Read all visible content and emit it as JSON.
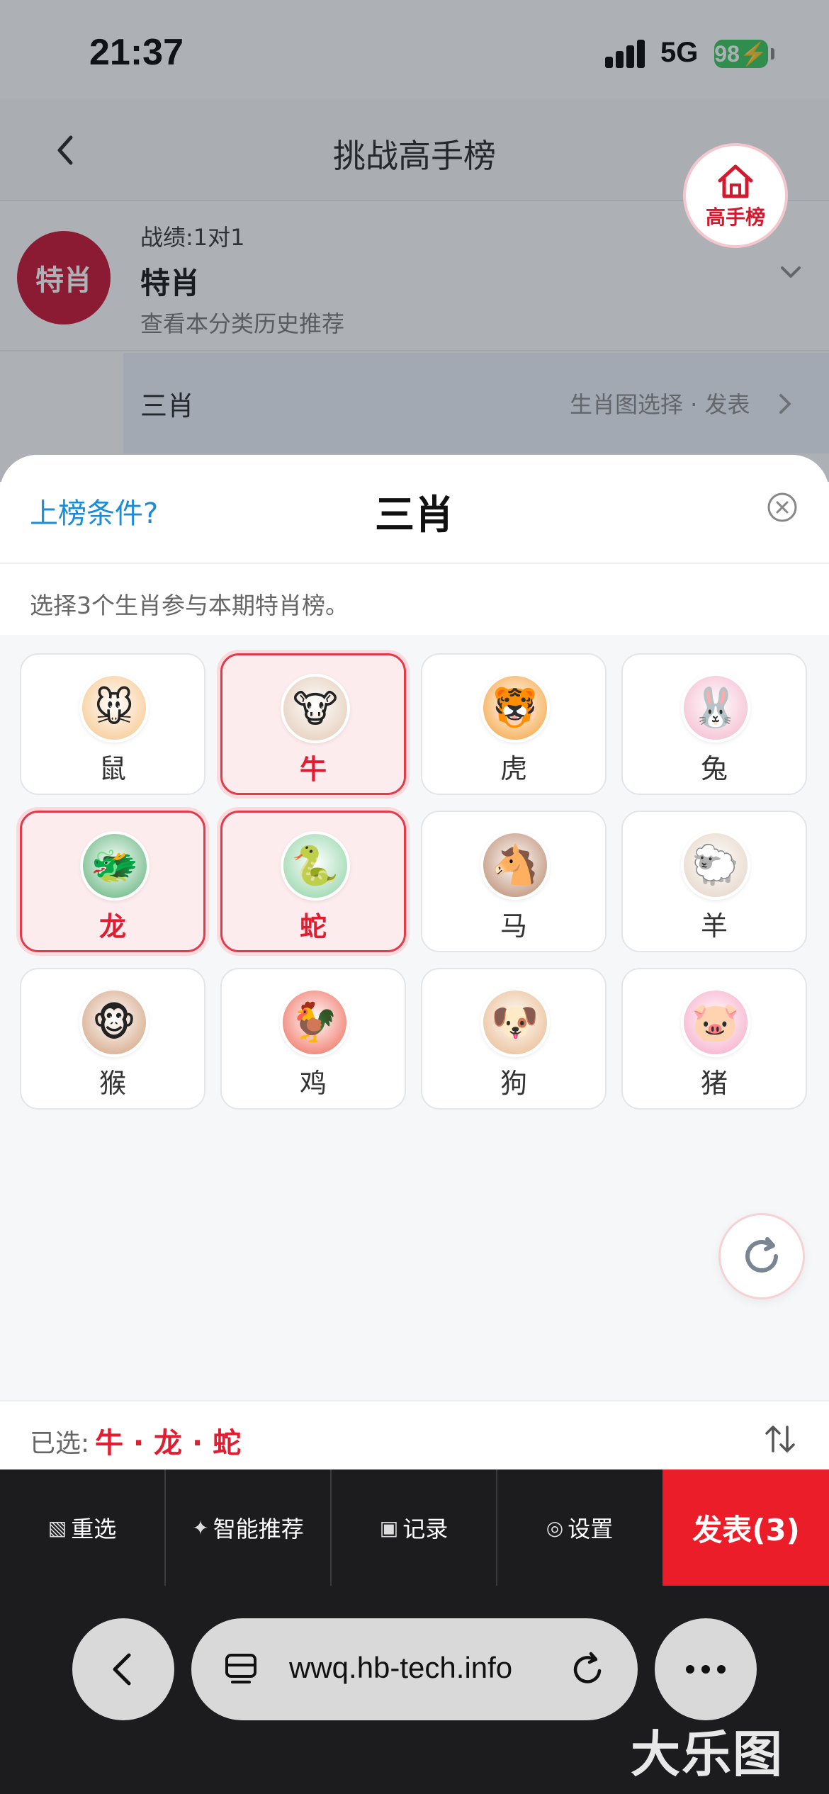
{
  "status_bar": {
    "time": "21:37",
    "network": "5G",
    "battery": "98"
  },
  "nav": {
    "title": "挑战高手榜",
    "badge_label": "高手榜"
  },
  "record": {
    "avatar_text": "特肖",
    "score": "战绩:1对1",
    "name": "特肖",
    "subtitle": "查看本分类历史推荐"
  },
  "category": {
    "name": "三肖",
    "meta": "生肖图选择 · 发表"
  },
  "sheet": {
    "condition_link": "上榜条件?",
    "title": "三肖",
    "instruction": "选择3个生肖参与本期特肖榜。"
  },
  "zodiacs": [
    {
      "label": "鼠",
      "icon": "mouse-face",
      "emoji": "🐭",
      "bg": "#f6c58a",
      "selected": false
    },
    {
      "label": "牛",
      "icon": "cow-face",
      "emoji": "🐮",
      "bg": "#e2c9b4",
      "selected": true
    },
    {
      "label": "虎",
      "icon": "tiger-face",
      "emoji": "🐯",
      "bg": "#f4a13a",
      "selected": false
    },
    {
      "label": "兔",
      "icon": "rabbit-face",
      "emoji": "🐰",
      "bg": "#f4b7cd",
      "selected": false
    },
    {
      "label": "龙",
      "icon": "dragon-face",
      "emoji": "🐲",
      "bg": "#5fb27a",
      "selected": true
    },
    {
      "label": "蛇",
      "icon": "snake",
      "emoji": "🐍",
      "bg": "#8fd3a5",
      "selected": true
    },
    {
      "label": "马",
      "icon": "horse-face",
      "emoji": "🐴",
      "bg": "#b9876b",
      "selected": false
    },
    {
      "label": "羊",
      "icon": "sheep",
      "emoji": "🐑",
      "bg": "#e4d3c3",
      "selected": false
    },
    {
      "label": "猴",
      "icon": "monkey-face",
      "emoji": "🐵",
      "bg": "#d2a07e",
      "selected": false
    },
    {
      "label": "鸡",
      "icon": "rooster",
      "emoji": "🐓",
      "bg": "#ef6a5a",
      "selected": false
    },
    {
      "label": "狗",
      "icon": "dog-face",
      "emoji": "🐶",
      "bg": "#e8b88c",
      "selected": false
    },
    {
      "label": "猪",
      "icon": "pig-face",
      "emoji": "🐷",
      "bg": "#f6a8c6",
      "selected": false
    }
  ],
  "selection": {
    "prefix": "已选:",
    "value": "牛 · 龙 · 蛇"
  },
  "toolbar": {
    "reset_icon": "▧",
    "reset": "重选",
    "smart_icon": "✦",
    "smart": "智能推荐",
    "record_icon": "▣",
    "record": "记录",
    "settings_icon": "◎",
    "settings": "设置",
    "publish": "发表(3)"
  },
  "browser": {
    "url": "wwq.hb-tech.info",
    "watermark": "大乐图"
  },
  "colors": {
    "accent_red": "#e01e31",
    "link_blue": "#1a8dd6",
    "publish_bg": "#ea1d28"
  }
}
